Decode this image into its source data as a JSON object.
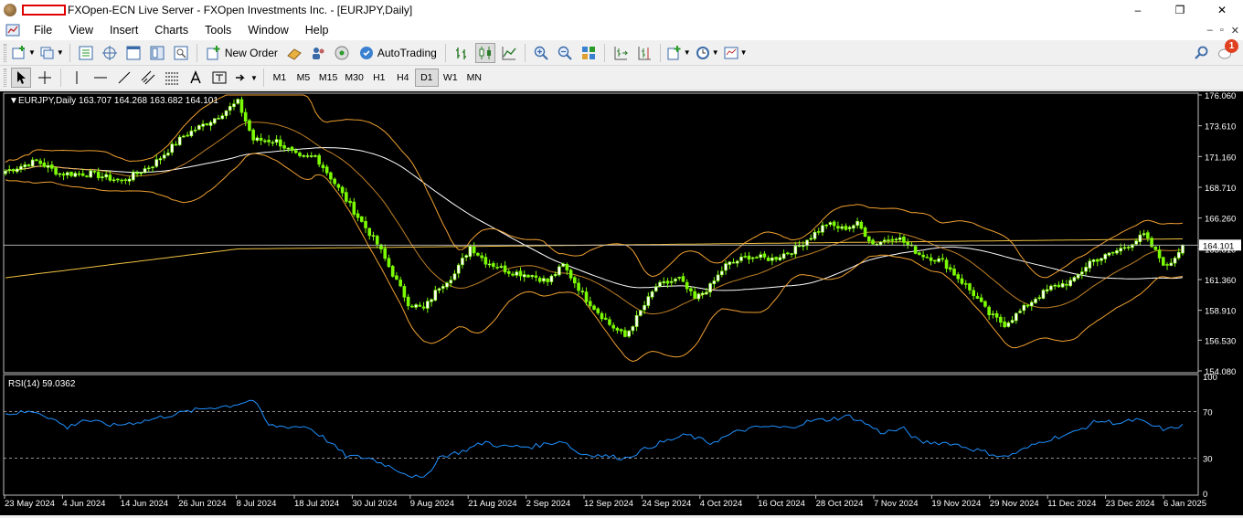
{
  "window": {
    "title": "FXOpen-ECN Live Server - FXOpen Investments Inc. - [EURJPY,Daily]",
    "minimize": "–",
    "maximize": "❐",
    "close": "✕"
  },
  "menu": {
    "items": [
      "File",
      "View",
      "Insert",
      "Charts",
      "Tools",
      "Window",
      "Help"
    ],
    "mdi": [
      "–",
      "▫",
      "✕"
    ]
  },
  "toolbar": {
    "new_order_label": "New Order",
    "autotrading_label": "AutoTrading",
    "notification_count": "1"
  },
  "timeframes": {
    "items": [
      "M1",
      "M5",
      "M15",
      "M30",
      "H1",
      "H4",
      "D1",
      "W1",
      "MN"
    ],
    "active": "D1"
  },
  "colors": {
    "bull_candle": "#ffffff",
    "bear_candle": "#7cfc00",
    "wick": "#7cfc00",
    "bollinger": "#f0a030",
    "ma_long": "#f0c040",
    "ma_mid": "#ffffff",
    "rsi_line": "#1e90ff",
    "current_price_line": "#c0c0c0"
  },
  "chart_data": [
    {
      "type": "line",
      "title": "EURJPY,Daily",
      "ohlc_label": "163.707 164.268 163.682 164.101",
      "current_price": 164.101,
      "current_price_label": "164.101",
      "ylim": [
        154.08,
        176.06
      ],
      "y_ticks": [
        176.06,
        173.61,
        171.16,
        168.71,
        166.26,
        163.81,
        161.36,
        158.91,
        156.53,
        154.08
      ],
      "y_tick_labels": [
        "176.060",
        "173.610",
        "171.160",
        "168.710",
        "166.260",
        "163.810",
        "161.360",
        "158.910",
        "156.530",
        "154.080"
      ],
      "x_tick_labels": [
        "23 May 2024",
        "4 Jun 2024",
        "14 Jun 2024",
        "26 Jun 2024",
        "8 Jul 2024",
        "18 Jul 2024",
        "30 Jul 2024",
        "9 Aug 2024",
        "21 Aug 2024",
        "2 Sep 2024",
        "12 Sep 2024",
        "24 Sep 2024",
        "4 Oct 2024",
        "16 Oct 2024",
        "28 Oct 2024",
        "7 Nov 2024",
        "19 Nov 2024",
        "29 Nov 2024",
        "11 Dec 2024",
        "23 Dec 2024",
        "6 Jan 2025"
      ],
      "close_anchors": [
        [
          0,
          170.0
        ],
        [
          8,
          170.8
        ],
        [
          14,
          169.8
        ],
        [
          22,
          169.8
        ],
        [
          30,
          169.2
        ],
        [
          38,
          170.5
        ],
        [
          46,
          172.8
        ],
        [
          54,
          174.2
        ],
        [
          60,
          175.5
        ],
        [
          64,
          172.5
        ],
        [
          70,
          172.4
        ],
        [
          76,
          171.0
        ],
        [
          80,
          171.2
        ],
        [
          84,
          169.5
        ],
        [
          90,
          166.8
        ],
        [
          96,
          164.2
        ],
        [
          100,
          161.8
        ],
        [
          104,
          159.5
        ],
        [
          108,
          159.0
        ],
        [
          112,
          160.8
        ],
        [
          116,
          161.8
        ],
        [
          120,
          164.0
        ],
        [
          124,
          162.8
        ],
        [
          130,
          162.0
        ],
        [
          136,
          161.7
        ],
        [
          140,
          161.2
        ],
        [
          144,
          162.5
        ],
        [
          150,
          159.8
        ],
        [
          156,
          157.8
        ],
        [
          160,
          156.8
        ],
        [
          164,
          158.8
        ],
        [
          168,
          160.8
        ],
        [
          174,
          161.4
        ],
        [
          178,
          159.8
        ],
        [
          182,
          160.8
        ],
        [
          186,
          162.5
        ],
        [
          192,
          163.2
        ],
        [
          198,
          163.0
        ],
        [
          204,
          163.8
        ],
        [
          208,
          164.8
        ],
        [
          212,
          165.8
        ],
        [
          216,
          165.4
        ],
        [
          220,
          165.8
        ],
        [
          224,
          164.2
        ],
        [
          230,
          164.8
        ],
        [
          236,
          163.4
        ],
        [
          242,
          162.8
        ],
        [
          246,
          161.5
        ],
        [
          250,
          160.2
        ],
        [
          254,
          158.6
        ],
        [
          258,
          157.8
        ],
        [
          262,
          158.8
        ],
        [
          266,
          159.9
        ],
        [
          270,
          160.7
        ],
        [
          276,
          161.3
        ],
        [
          280,
          162.8
        ],
        [
          284,
          163.2
        ],
        [
          288,
          163.8
        ],
        [
          292,
          164.5
        ],
        [
          294,
          164.9
        ],
        [
          298,
          163.1
        ],
        [
          300,
          162.3
        ],
        [
          304,
          164.101
        ]
      ],
      "indicators": [
        "Bollinger Bands",
        "Moving Average (mid)",
        "Moving Average (long)"
      ]
    },
    {
      "type": "line",
      "title": "RSI(14) 59.0362",
      "ylim": [
        0,
        100
      ],
      "levels": [
        70,
        30
      ],
      "y_tick_labels": [
        "100",
        "70",
        "30",
        "0"
      ],
      "series": [
        {
          "name": "RSI(14)",
          "points": [
            [
              0,
              68
            ],
            [
              8,
              70
            ],
            [
              12,
              64
            ],
            [
              16,
              56
            ],
            [
              20,
              63
            ],
            [
              28,
              58
            ],
            [
              36,
              62
            ],
            [
              44,
              68
            ],
            [
              52,
              73
            ],
            [
              58,
              75
            ],
            [
              64,
              80
            ],
            [
              68,
              58
            ],
            [
              72,
              57
            ],
            [
              78,
              57
            ],
            [
              82,
              48
            ],
            [
              88,
              32
            ],
            [
              94,
              30
            ],
            [
              100,
              22
            ],
            [
              104,
              16
            ],
            [
              108,
              12
            ],
            [
              112,
              31
            ],
            [
              118,
              36
            ],
            [
              124,
              44
            ],
            [
              128,
              40
            ],
            [
              136,
              40
            ],
            [
              144,
              45
            ],
            [
              148,
              34
            ],
            [
              152,
              33
            ],
            [
              160,
              30
            ],
            [
              168,
              42
            ],
            [
              176,
              50
            ],
            [
              182,
              43
            ],
            [
              190,
              54
            ],
            [
              196,
              57
            ],
            [
              202,
              56
            ],
            [
              208,
              62
            ],
            [
              212,
              63
            ],
            [
              218,
              66
            ],
            [
              222,
              60
            ],
            [
              226,
              52
            ],
            [
              232,
              55
            ],
            [
              236,
              44
            ],
            [
              244,
              43
            ],
            [
              252,
              36
            ],
            [
              258,
              31
            ],
            [
              262,
              36
            ],
            [
              268,
              45
            ],
            [
              276,
              52
            ],
            [
              282,
              62
            ],
            [
              288,
              60
            ],
            [
              292,
              63
            ],
            [
              296,
              58
            ],
            [
              300,
              54
            ],
            [
              304,
              59.04
            ]
          ]
        }
      ]
    }
  ]
}
